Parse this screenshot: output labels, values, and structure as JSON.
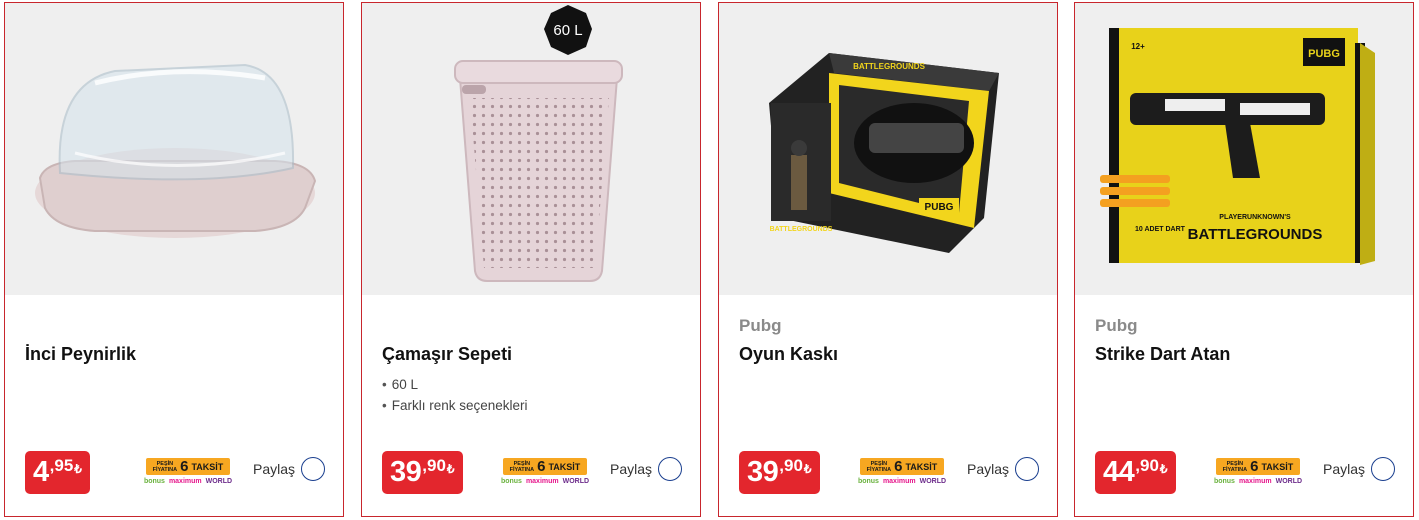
{
  "products": [
    {
      "brand": "",
      "title": "İnci Peynirlik",
      "features": [],
      "price": {
        "main": "4",
        "decimal": ",95",
        "currency": "₺"
      },
      "share_label": "Paylaş",
      "image_icon": "cheese-container-image"
    },
    {
      "brand": "",
      "title": "Çamaşır Sepeti",
      "features": [
        "60 L",
        "Farklı renk seçenekleri"
      ],
      "badge": "60 L",
      "price": {
        "main": "39",
        "decimal": ",90",
        "currency": "₺"
      },
      "share_label": "Paylaş",
      "image_icon": "laundry-basket-image"
    },
    {
      "brand": "Pubg",
      "title": "Oyun Kaskı",
      "features": [],
      "price": {
        "main": "39",
        "decimal": ",90",
        "currency": "₺"
      },
      "share_label": "Paylaş",
      "image_icon": "helmet-box-image"
    },
    {
      "brand": "Pubg",
      "title": "Strike Dart Atan",
      "features": [],
      "price": {
        "main": "44",
        "decimal": ",90",
        "currency": "₺"
      },
      "share_label": "Paylaş",
      "image_icon": "dart-blaster-box-image"
    }
  ],
  "installment_badge": {
    "prefix_line1": "PEŞİN",
    "prefix_line2": "FİYATINA",
    "number": "6",
    "word": "TAKSİT",
    "brands": [
      "bonus",
      "maximum",
      "WORLD"
    ]
  },
  "product_art_text": {
    "box_logo": "PUBG",
    "box_title": "BATTLEGROUNDS",
    "blaster_subtitle": "PLAYERUNKNOWN'S",
    "dart_count": "10 ADET DART",
    "age": "12+"
  },
  "colors": {
    "border": "#c8262d",
    "price_bg": "#e3262d",
    "taksit_bg": "#f7a721",
    "share_circle": "#1a3f8f"
  }
}
